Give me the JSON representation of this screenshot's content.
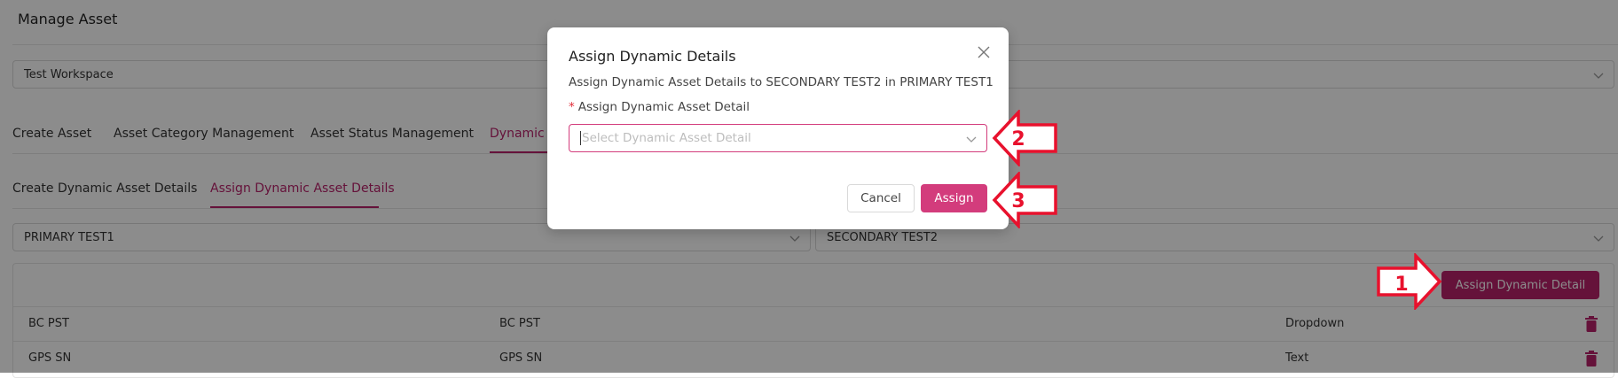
{
  "page": {
    "title": "Manage Asset",
    "workspace_select": "Test Workspace",
    "tabs": [
      {
        "label": "Create Asset"
      },
      {
        "label": "Asset Category Management"
      },
      {
        "label": "Asset Status Management"
      },
      {
        "label": "Dynamic A"
      }
    ],
    "subtabs": [
      {
        "label": "Create Dynamic Asset Details"
      },
      {
        "label": "Assign Dynamic Asset Details"
      }
    ],
    "primary_select": "PRIMARY TEST1",
    "secondary_select": "SECONDARY TEST2",
    "assign_button_label": "Assign Dynamic Detail",
    "rows": [
      {
        "col1": "BC PST",
        "col2": "BC PST",
        "type": "Dropdown"
      },
      {
        "col1": "GPS SN",
        "col2": "GPS SN",
        "type": "Text"
      }
    ]
  },
  "modal": {
    "title": "Assign Dynamic Details",
    "description": "Assign Dynamic Asset Details to SECONDARY TEST2 in PRIMARY TEST1",
    "required_mark": "*",
    "field_label": "Assign Dynamic Asset Detail",
    "field_placeholder": "Select Dynamic Asset Detail",
    "cancel_label": "Cancel",
    "assign_label": "Assign"
  },
  "callouts": [
    {
      "number": "1"
    },
    {
      "number": "2"
    },
    {
      "number": "3"
    }
  ],
  "colors": {
    "accent": "#b8226b",
    "modal_button": "#d33c7c",
    "callout_red": "#e8112d"
  },
  "icons": [
    "chevron-down-icon",
    "close-icon",
    "trash-icon"
  ]
}
